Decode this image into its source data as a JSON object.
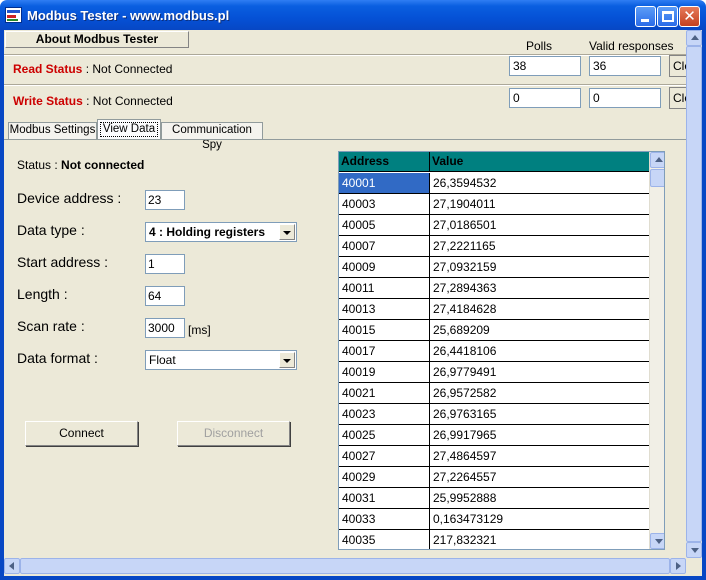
{
  "window": {
    "title": "Modbus Tester - www.modbus.pl"
  },
  "toolbar": {
    "about_label": "About Modbus Tester",
    "polls_label": "Polls",
    "valid_label": "Valid responses",
    "clear_label": "Clear"
  },
  "read": {
    "label": "Read Status",
    "value": ": Not Connected",
    "polls": "38",
    "valid": "36"
  },
  "write": {
    "label": "Write Status",
    "value": ": Not Connected",
    "polls": "0",
    "valid": "0"
  },
  "tabs": [
    {
      "label": "Modbus Settings"
    },
    {
      "label": "View Data"
    },
    {
      "label": "Communication Spy"
    }
  ],
  "form": {
    "status_label": "Status :",
    "status_value": "Not connected",
    "device_address_label": "Device address :",
    "device_address": "23",
    "data_type_label": "Data type :",
    "data_type": "4 : Holding registers",
    "start_address_label": "Start address :",
    "start_address": "1",
    "length_label": "Length :",
    "length": "64",
    "scan_rate_label": "Scan rate :",
    "scan_rate": "3000",
    "scan_rate_unit": "[ms]",
    "data_format_label": "Data format :",
    "data_format": "Float",
    "connect_label": "Connect",
    "disconnect_label": "Disconnect"
  },
  "grid": {
    "col_address": "Address",
    "col_value": "Value",
    "rows": [
      {
        "address": "40001",
        "value": "26,3594532"
      },
      {
        "address": "40003",
        "value": "27,1904011"
      },
      {
        "address": "40005",
        "value": "27,0186501"
      },
      {
        "address": "40007",
        "value": "27,2221165"
      },
      {
        "address": "40009",
        "value": "27,0932159"
      },
      {
        "address": "40011",
        "value": "27,2894363"
      },
      {
        "address": "40013",
        "value": "27,4184628"
      },
      {
        "address": "40015",
        "value": "25,689209"
      },
      {
        "address": "40017",
        "value": "26,4418106"
      },
      {
        "address": "40019",
        "value": "26,9779491"
      },
      {
        "address": "40021",
        "value": "26,9572582"
      },
      {
        "address": "40023",
        "value": "26,9763165"
      },
      {
        "address": "40025",
        "value": "26,9917965"
      },
      {
        "address": "40027",
        "value": "27,4864597"
      },
      {
        "address": "40029",
        "value": "27,2264557"
      },
      {
        "address": "40031",
        "value": "25,9952888"
      },
      {
        "address": "40033",
        "value": "0,163473129"
      },
      {
        "address": "40035",
        "value": "217,832321"
      }
    ]
  },
  "colors": {
    "title_bar": "#0551d6",
    "status_label": "#cc0000",
    "grid_header": "#008080",
    "selection": "#316ac5"
  }
}
